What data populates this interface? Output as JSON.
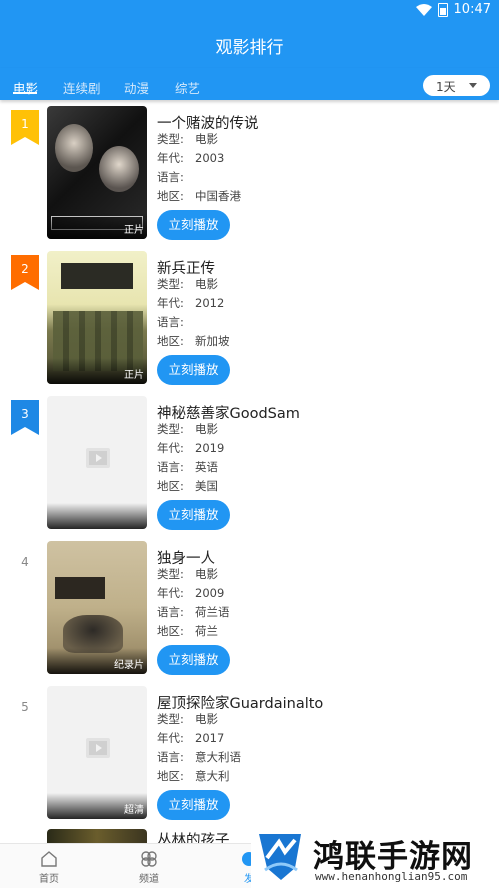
{
  "status": {
    "time": "10:47"
  },
  "app": {
    "title": "观影排行"
  },
  "tabs": [
    {
      "label": "电影",
      "active": true
    },
    {
      "label": "连续剧",
      "active": false
    },
    {
      "label": "动漫",
      "active": false
    },
    {
      "label": "综艺",
      "active": false
    }
  ],
  "day_filter": {
    "selected": "1天"
  },
  "field_labels": {
    "type": "类型:",
    "year": "年代:",
    "lang": "语言:",
    "region": "地区:"
  },
  "play_label": "立刻播放",
  "items": [
    {
      "rank": "1",
      "title": "一个赌波的传说",
      "type": "电影",
      "year": "2003",
      "lang": "",
      "region": "中国香港",
      "quality": "正片",
      "badge_color": "#ffc107"
    },
    {
      "rank": "2",
      "title": "新兵正传",
      "type": "电影",
      "year": "2012",
      "lang": "",
      "region": "新加坡",
      "quality": "正片",
      "badge_color": "#ff6d00"
    },
    {
      "rank": "3",
      "title": "神秘慈善家GoodSam",
      "type": "电影",
      "year": "2019",
      "lang": "英语",
      "region": "美国",
      "quality": "",
      "badge_color": "#1e88e5"
    },
    {
      "rank": "4",
      "title": "独身一人",
      "type": "电影",
      "year": "2009",
      "lang": "荷兰语",
      "region": "荷兰",
      "quality": "纪录片"
    },
    {
      "rank": "5",
      "title": "屋顶探险家Guardainalto",
      "type": "电影",
      "year": "2017",
      "lang": "意大利语",
      "region": "意大利",
      "quality": "超清"
    }
  ],
  "partial_item": {
    "title": "丛林的孩子"
  },
  "bottom_nav": [
    {
      "label": "首页",
      "icon": "home-icon"
    },
    {
      "label": "频道",
      "icon": "channel-icon"
    },
    {
      "label": "发",
      "icon": "discover-icon",
      "active": true
    }
  ],
  "watermark": {
    "title": "鸿联手游网",
    "url": "www.henanhonglian95.com"
  }
}
